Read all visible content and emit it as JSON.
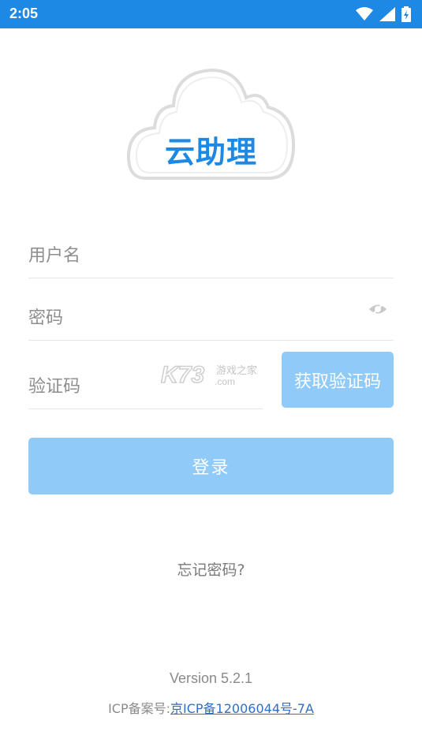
{
  "status_bar": {
    "time": "2:05"
  },
  "logo": {
    "text": "云助理"
  },
  "form": {
    "username_placeholder": "用户名",
    "password_placeholder": "密码",
    "code_placeholder": "验证码",
    "get_code_label": "获取验证码"
  },
  "watermark": {
    "text": "K73",
    "sub": "游戏之家",
    "domain": ".com"
  },
  "login_label": "登录",
  "forgot_label": "忘记密码?",
  "footer": {
    "version": "Version  5.2.1",
    "icp_prefix": "ICP备案号:",
    "icp_link": "京ICP备12006044号-7A"
  },
  "colors": {
    "primary": "#1e88e5",
    "button": "#90caf9"
  },
  "icons": [
    "wifi-icon",
    "signal-icon",
    "battery-icon",
    "eye-icon"
  ]
}
